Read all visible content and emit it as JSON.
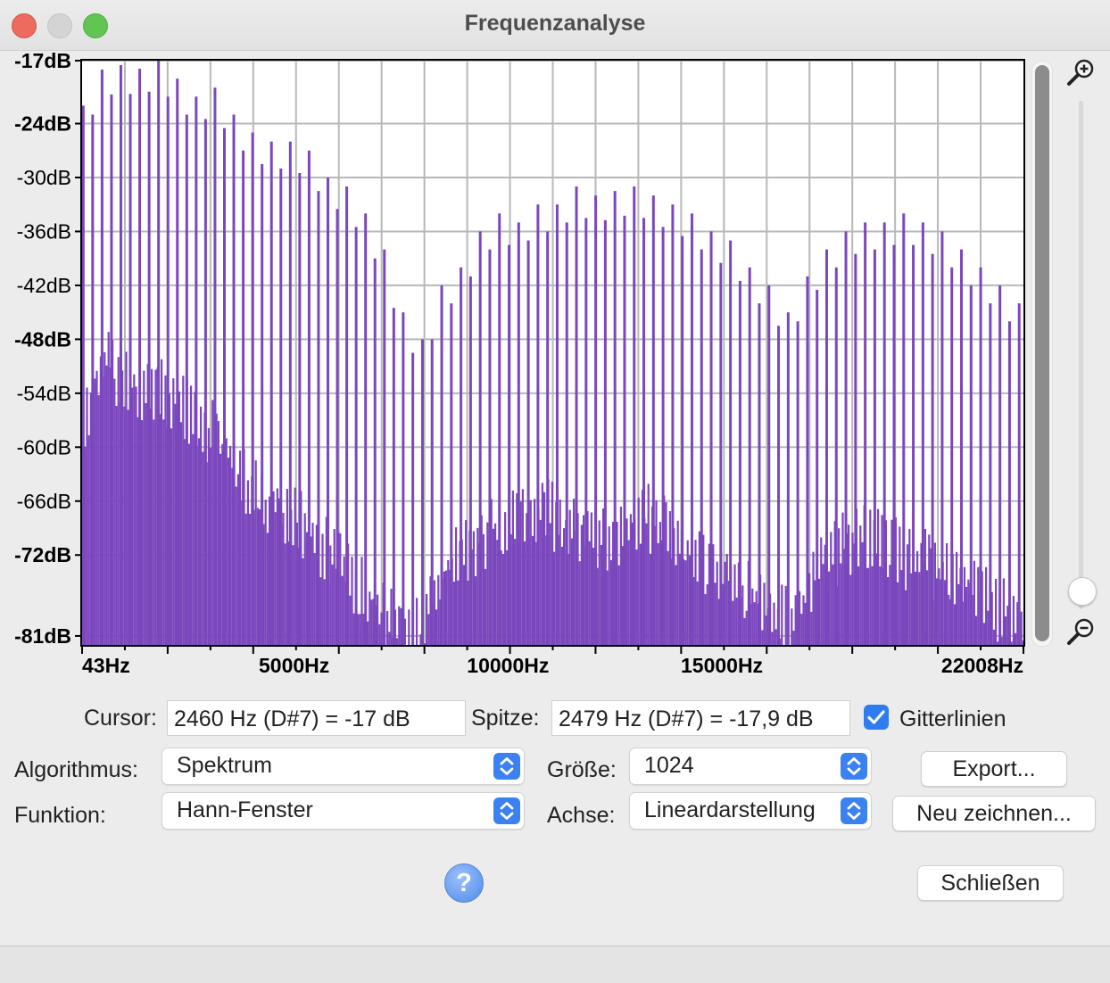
{
  "window": {
    "title": "Frequenzanalyse"
  },
  "chart_data": {
    "type": "bar",
    "title": "",
    "xlabel": "",
    "ylabel": "",
    "x_ticks": [
      "43Hz",
      "5000Hz",
      "10000Hz",
      "15000Hz",
      "22008Hz"
    ],
    "x_tick_values": [
      43,
      5000,
      10000,
      15000,
      22008
    ],
    "xlim": [
      43,
      22050
    ],
    "y_ticks": [
      "-17dB",
      "-24dB",
      "-30dB",
      "-36dB",
      "-42dB",
      "-48dB",
      "-54dB",
      "-60dB",
      "-66dB",
      "-72dB",
      "-81dB"
    ],
    "y_tick_values": [
      -17,
      -24,
      -30,
      -36,
      -42,
      -48,
      -54,
      -60,
      -66,
      -72,
      -81
    ],
    "ylim": [
      -82,
      -17
    ],
    "grid": true,
    "color": "#7b47bd",
    "series": [
      {
        "x_hz": [
          70,
          510,
          950,
          1390,
          1830,
          2270,
          2710,
          3150,
          3590,
          4030,
          4470,
          4910,
          5350,
          5790,
          6230,
          6670,
          7110,
          7550,
          8000,
          8450,
          8900,
          9350,
          9800,
          10250,
          10700,
          11150,
          11600,
          12050,
          12500,
          12950,
          13400,
          13850,
          14300,
          14750,
          15200,
          15650,
          16100,
          16550,
          17000,
          17450,
          17900,
          18350,
          18800,
          19250,
          19700,
          20150,
          20600,
          21050,
          21500,
          21950
        ],
        "peak_db": [
          -22,
          -18,
          -17.5,
          -17.9,
          -17,
          -19,
          -21,
          -20,
          -23,
          -25,
          -26,
          -26,
          -27,
          -30,
          -31,
          -34,
          -38,
          -45,
          -48,
          -42,
          -40,
          -36,
          -34,
          -35,
          -33,
          -33,
          -31,
          -32,
          -31.5,
          -31,
          -32,
          -33,
          -34,
          -36,
          -37,
          -40,
          -42,
          -45,
          -41,
          -38,
          -36,
          -35,
          -35,
          -34,
          -35,
          -36,
          -38,
          -40,
          -42,
          -44
        ],
        "floor_db": [
          -55,
          -48,
          -50,
          -52,
          -52,
          -53,
          -55,
          -57,
          -60,
          -63,
          -65,
          -66,
          -67,
          -70,
          -72,
          -74,
          -77,
          -79,
          -78,
          -72,
          -70,
          -68,
          -66,
          -66,
          -65,
          -66,
          -67,
          -68,
          -68,
          -66,
          -66,
          -68,
          -70,
          -72,
          -73,
          -74,
          -76,
          -77,
          -74,
          -70,
          -69,
          -68,
          -69,
          -70,
          -71,
          -72,
          -73,
          -74,
          -76,
          -78
        ]
      }
    ]
  },
  "controls": {
    "cursor_label": "Cursor:",
    "cursor_value": "2460 Hz (D#7) = -17 dB",
    "peak_label": "Spitze:",
    "peak_value": "2479 Hz (D#7) = -17,9 dB",
    "grid_label": "Gitterlinien",
    "grid_checked": true,
    "algorithm_label": "Algorithmus:",
    "algorithm_value": "Spektrum",
    "size_label": "Größe:",
    "size_value": "1024",
    "function_label": "Funktion:",
    "function_value": "Hann-Fenster",
    "axis_label": "Achse:",
    "axis_value": "Lineardarstellung",
    "export_button": "Export...",
    "redraw_button": "Neu zeichnen...",
    "close_button": "Schließen",
    "help_glyph": "?"
  },
  "icons": {
    "zoom_in": "zoom-in-icon",
    "zoom_out": "zoom-out-icon",
    "help": "help-icon",
    "accent_color": "#2f7bf0"
  }
}
